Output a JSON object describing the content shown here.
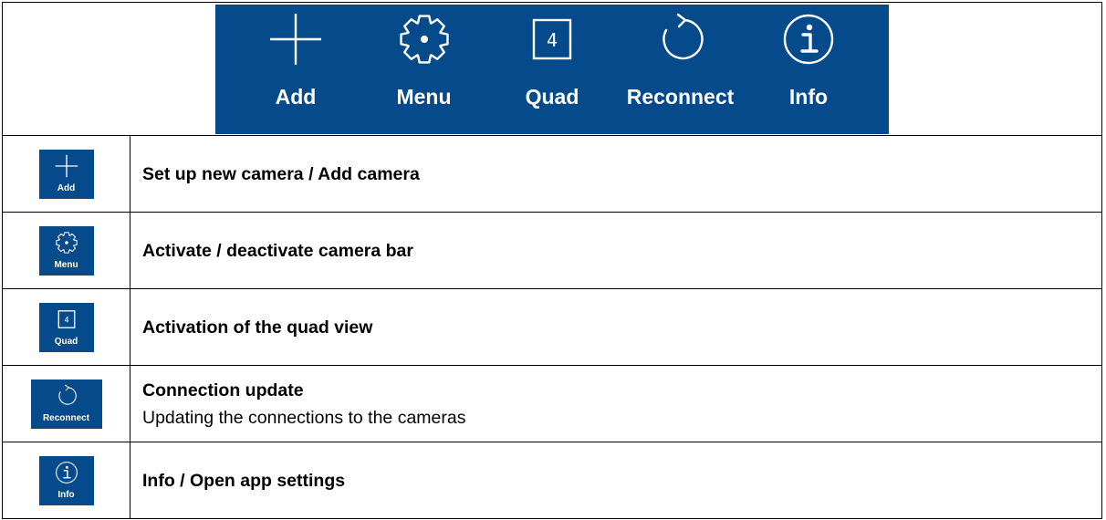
{
  "colors": {
    "accent": "#054a8a",
    "icon_stroke": "#ffffff",
    "border": "#000000"
  },
  "toolbar": {
    "buttons": [
      {
        "label": "Add",
        "icon": "plus-icon"
      },
      {
        "label": "Menu",
        "icon": "gear-icon"
      },
      {
        "label": "Quad",
        "icon": "quad-icon",
        "icon_text": "4"
      },
      {
        "label": "Reconnect",
        "icon": "reconnect-icon"
      },
      {
        "label": "Info",
        "icon": "info-icon"
      }
    ]
  },
  "rows": [
    {
      "icon_label": "Add",
      "icon": "plus-icon",
      "title": "Set up new camera / Add camera",
      "description": ""
    },
    {
      "icon_label": "Menu",
      "icon": "gear-icon",
      "title": "Activate / deactivate camera bar",
      "description": ""
    },
    {
      "icon_label": "Quad",
      "icon": "quad-icon",
      "icon_text": "4",
      "title": "Activation of the quad view",
      "description": ""
    },
    {
      "icon_label": "Reconnect",
      "icon": "reconnect-icon",
      "title": "Connection update",
      "description": "Updating the connections to the cameras"
    },
    {
      "icon_label": "Info",
      "icon": "info-icon",
      "title": "Info / Open app settings",
      "description": ""
    }
  ]
}
